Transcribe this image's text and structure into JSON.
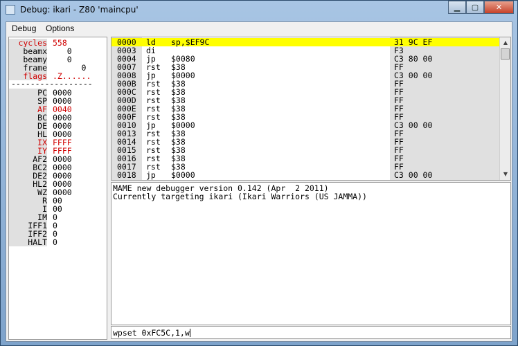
{
  "window": {
    "title": "Debug: ikari - Z80 'maincpu'"
  },
  "menu": {
    "items": [
      "Debug",
      "Options"
    ]
  },
  "registers": [
    {
      "name": "cycles",
      "value": "558",
      "red": true
    },
    {
      "name": "beamx",
      "value": "   0",
      "red": false
    },
    {
      "name": "beamy",
      "value": "   0",
      "red": false
    },
    {
      "name": "frame",
      "value": "      0",
      "red": false
    },
    {
      "name": "flags",
      "value": ".Z......",
      "red": true
    },
    {
      "name": "PC",
      "value": "0000",
      "red": false
    },
    {
      "name": "SP",
      "value": "0000",
      "red": false
    },
    {
      "name": "AF",
      "value": "0040",
      "red": true
    },
    {
      "name": "BC",
      "value": "0000",
      "red": false
    },
    {
      "name": "DE",
      "value": "0000",
      "red": false
    },
    {
      "name": "HL",
      "value": "0000",
      "red": false
    },
    {
      "name": "IX",
      "value": "FFFF",
      "red": true
    },
    {
      "name": "IY",
      "value": "FFFF",
      "red": true
    },
    {
      "name": "AF2",
      "value": "0000",
      "red": false
    },
    {
      "name": "BC2",
      "value": "0000",
      "red": false
    },
    {
      "name": "DE2",
      "value": "0000",
      "red": false
    },
    {
      "name": "HL2",
      "value": "0000",
      "red": false
    },
    {
      "name": "WZ",
      "value": "0000",
      "red": false
    },
    {
      "name": "R",
      "value": "00",
      "red": false
    },
    {
      "name": "I",
      "value": "00",
      "red": false
    },
    {
      "name": "IM",
      "value": "0",
      "red": false
    },
    {
      "name": "IFF1",
      "value": "0",
      "red": false
    },
    {
      "name": "IFF2",
      "value": "0",
      "red": false
    },
    {
      "name": "HALT",
      "value": "0",
      "red": false
    }
  ],
  "separator": "-----------------",
  "disassembly": [
    {
      "addr": "0000",
      "op": "ld",
      "arg": "sp,$EF9C",
      "bytes": "31 9C EF",
      "current": true
    },
    {
      "addr": "0003",
      "op": "di",
      "arg": "",
      "bytes": "F3",
      "current": false
    },
    {
      "addr": "0004",
      "op": "jp",
      "arg": "$0080",
      "bytes": "C3 80 00",
      "current": false
    },
    {
      "addr": "0007",
      "op": "rst",
      "arg": "$38",
      "bytes": "FF",
      "current": false
    },
    {
      "addr": "0008",
      "op": "jp",
      "arg": "$0000",
      "bytes": "C3 00 00",
      "current": false
    },
    {
      "addr": "000B",
      "op": "rst",
      "arg": "$38",
      "bytes": "FF",
      "current": false
    },
    {
      "addr": "000C",
      "op": "rst",
      "arg": "$38",
      "bytes": "FF",
      "current": false
    },
    {
      "addr": "000D",
      "op": "rst",
      "arg": "$38",
      "bytes": "FF",
      "current": false
    },
    {
      "addr": "000E",
      "op": "rst",
      "arg": "$38",
      "bytes": "FF",
      "current": false
    },
    {
      "addr": "000F",
      "op": "rst",
      "arg": "$38",
      "bytes": "FF",
      "current": false
    },
    {
      "addr": "0010",
      "op": "jp",
      "arg": "$0000",
      "bytes": "C3 00 00",
      "current": false
    },
    {
      "addr": "0013",
      "op": "rst",
      "arg": "$38",
      "bytes": "FF",
      "current": false
    },
    {
      "addr": "0014",
      "op": "rst",
      "arg": "$38",
      "bytes": "FF",
      "current": false
    },
    {
      "addr": "0015",
      "op": "rst",
      "arg": "$38",
      "bytes": "FF",
      "current": false
    },
    {
      "addr": "0016",
      "op": "rst",
      "arg": "$38",
      "bytes": "FF",
      "current": false
    },
    {
      "addr": "0017",
      "op": "rst",
      "arg": "$38",
      "bytes": "FF",
      "current": false
    },
    {
      "addr": "0018",
      "op": "jp",
      "arg": "$0000",
      "bytes": "C3 00 00",
      "current": false
    }
  ],
  "console": {
    "lines": [
      "MAME new debugger version 0.142 (Apr  2 2011)",
      "Currently targeting ikari (Ikari Warriors (US JAMMA))"
    ]
  },
  "command": {
    "value": "wpset 0xFC5C,1,w"
  },
  "colors": {
    "highlight": "#ffff00",
    "changed": "#d00000"
  },
  "icons": {
    "minimize": "minimize-icon",
    "maximize": "maximize-icon",
    "close": "close-icon",
    "scroll_up": "arrow-up-icon",
    "scroll_down": "arrow-down-icon"
  }
}
